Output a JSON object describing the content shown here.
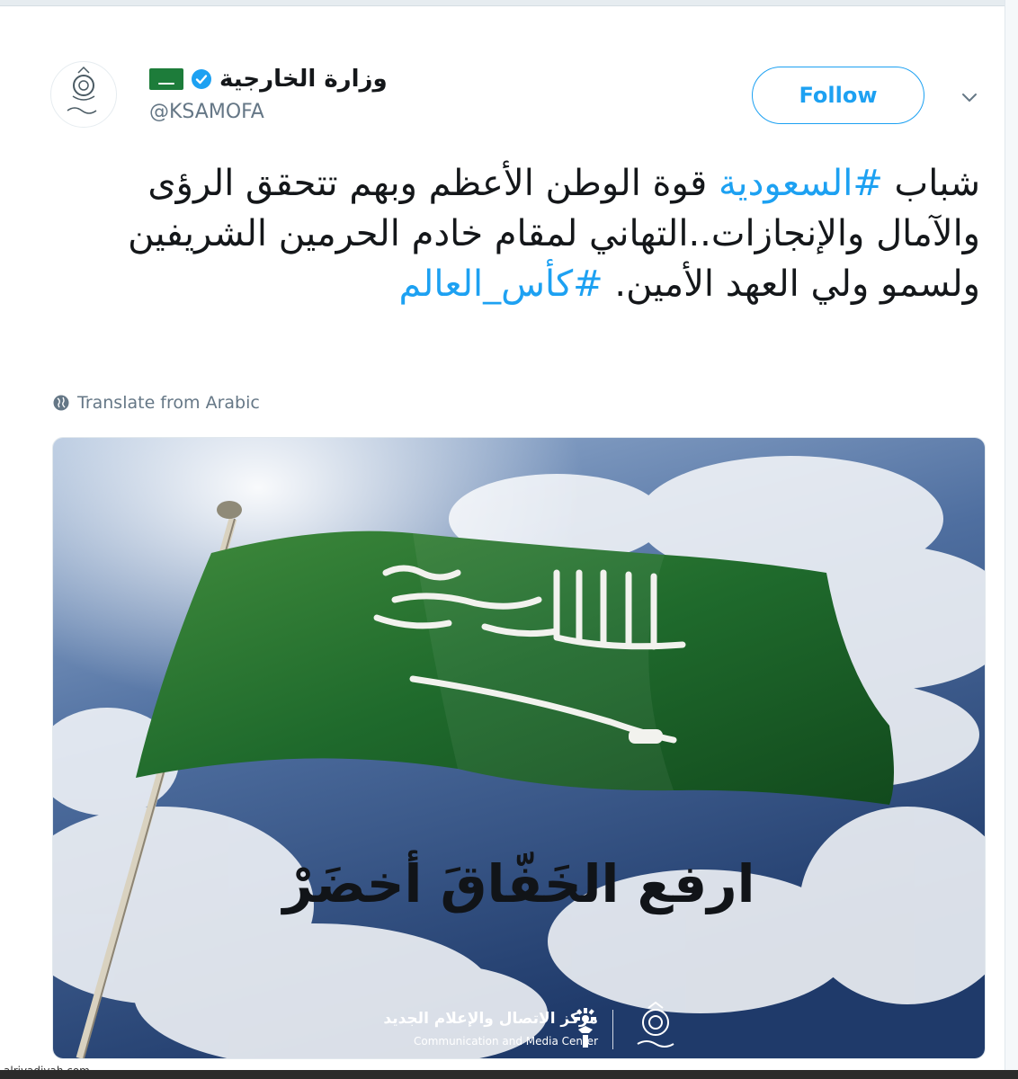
{
  "account": {
    "display_name": "وزارة الخارجية",
    "handle": "@KSAMOFA",
    "verified": true,
    "avatar_icon": "ministry-emblem-icon"
  },
  "actions": {
    "follow_label": "Follow",
    "more_icon": "chevron-down-icon"
  },
  "tweet": {
    "segments": [
      {
        "text": "شباب ",
        "hashtag": false
      },
      {
        "text": "#السعودية",
        "hashtag": true
      },
      {
        "text": " قوة الوطن الأعظم وبهم تتحقق الرؤى والآمال والإنجازات..التهاني لمقام خادم الحرمين الشريفين ولسمو ولي العهد الأمين. ",
        "hashtag": false
      },
      {
        "text": "#كأس_العالم",
        "hashtag": true
      }
    ],
    "translate_label": "Translate from Arabic"
  },
  "media": {
    "slogan": "ارفع الخَفّاقَ أخضَرْ",
    "org_name_ar": "مركز الاتصال والإعلام الجديد",
    "org_name_en": "Communication and Media Center"
  },
  "watermark": "alriyadiyah.com",
  "colors": {
    "accent": "#1da1f2",
    "text": "#14171a",
    "secondary": "#657786",
    "flag_green": "#1d7c3a"
  }
}
